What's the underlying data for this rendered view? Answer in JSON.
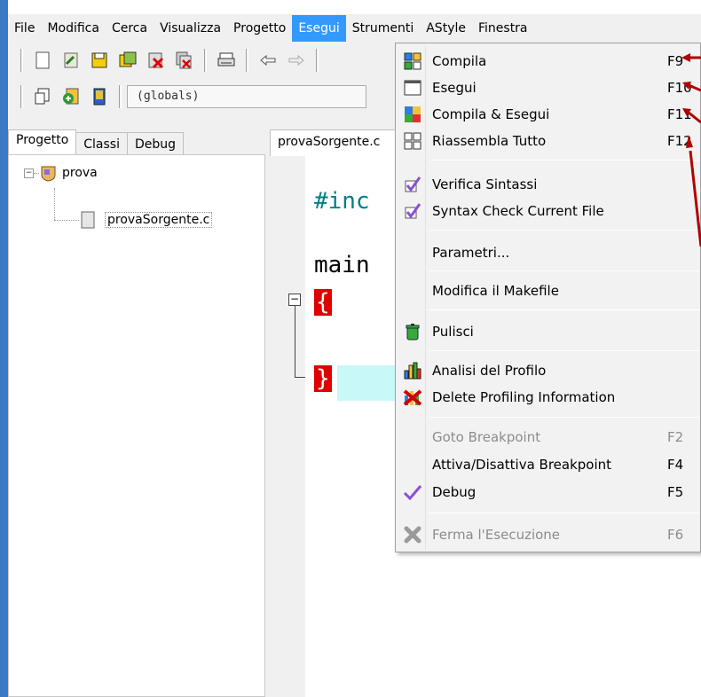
{
  "menubar": {
    "items": [
      "File",
      "Modifica",
      "Cerca",
      "Visualizza",
      "Progetto",
      "Esegui",
      "Strumenti",
      "AStyle",
      "Finestra"
    ]
  },
  "toolbar": {
    "scope_combo": "(globals)"
  },
  "left_panel": {
    "tabs": [
      "Progetto",
      "Classi",
      "Debug"
    ],
    "tree": {
      "project_name": "prova",
      "file_name": "provaSorgente.c"
    }
  },
  "editor": {
    "tab_label": "provaSorgente.c",
    "lines": [
      "#inc",
      "main",
      "{",
      "}"
    ]
  },
  "esegui_menu": {
    "items": [
      {
        "label": "Compila",
        "shortcut": "F9",
        "icon": "compile-icon"
      },
      {
        "label": "Esegui",
        "shortcut": "F10",
        "icon": "run-icon"
      },
      {
        "label": "Compila & Esegui",
        "shortcut": "F11",
        "icon": "compile-run-icon"
      },
      {
        "label": "Riassembla Tutto",
        "shortcut": "F12",
        "icon": "rebuild-all-icon"
      },
      {
        "label": "Verifica Sintassi",
        "shortcut": "",
        "icon": "syntax-check-icon"
      },
      {
        "label": "Syntax Check Current File",
        "shortcut": "",
        "icon": "syntax-check-file-icon"
      },
      {
        "label": "Parametri...",
        "shortcut": ""
      },
      {
        "label": "Modifica il Makefile",
        "shortcut": ""
      },
      {
        "label": "Pulisci",
        "shortcut": "",
        "icon": "clean-icon"
      },
      {
        "label": "Analisi del Profilo",
        "shortcut": "",
        "icon": "profile-icon"
      },
      {
        "label": "Delete Profiling Information",
        "shortcut": "",
        "icon": "delete-profile-icon"
      },
      {
        "label": "Goto Breakpoint",
        "shortcut": "F2",
        "disabled": true
      },
      {
        "label": "Attiva/Disattiva Breakpoint",
        "shortcut": "F4"
      },
      {
        "label": "Debug",
        "shortcut": "F5",
        "icon": "debug-check-icon"
      },
      {
        "label": "Ferma l'Esecuzione",
        "shortcut": "F6",
        "disabled": true,
        "icon": "stop-icon"
      }
    ]
  },
  "colors": {
    "menu_highlight": "#3399ff",
    "brace_highlight": "#e00000",
    "annotation_arrow": "#b00000"
  }
}
